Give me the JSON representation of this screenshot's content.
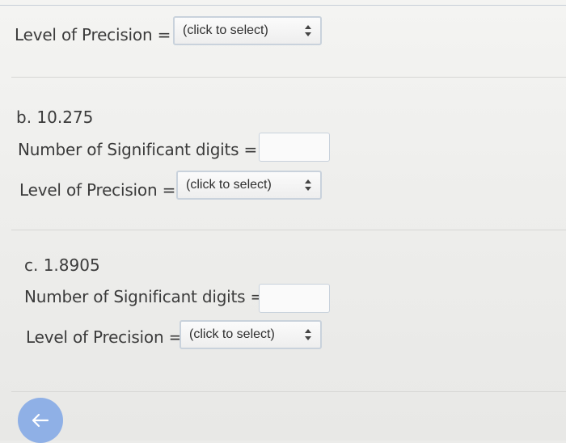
{
  "part_a": {
    "precision_label": "Level of Precision =",
    "precision_select": "(click to select)"
  },
  "part_b": {
    "heading": "b. 10.275",
    "sig_digits_label": "Number of Significant digits =",
    "sig_digits_value": "",
    "precision_label": "Level of Precision =",
    "precision_select": "(click to select)"
  },
  "part_c": {
    "heading": "c. 1.8905",
    "sig_digits_label": "Number of Significant digits =",
    "sig_digits_value": "",
    "precision_label": "Level of Precision =",
    "precision_select": "(click to select)"
  },
  "icons": {
    "select_arrows": "up-down-arrows-icon",
    "back": "arrow-left-icon"
  },
  "colors": {
    "select_border": "#c9d2dc",
    "back_button": "#8fb0e6"
  }
}
